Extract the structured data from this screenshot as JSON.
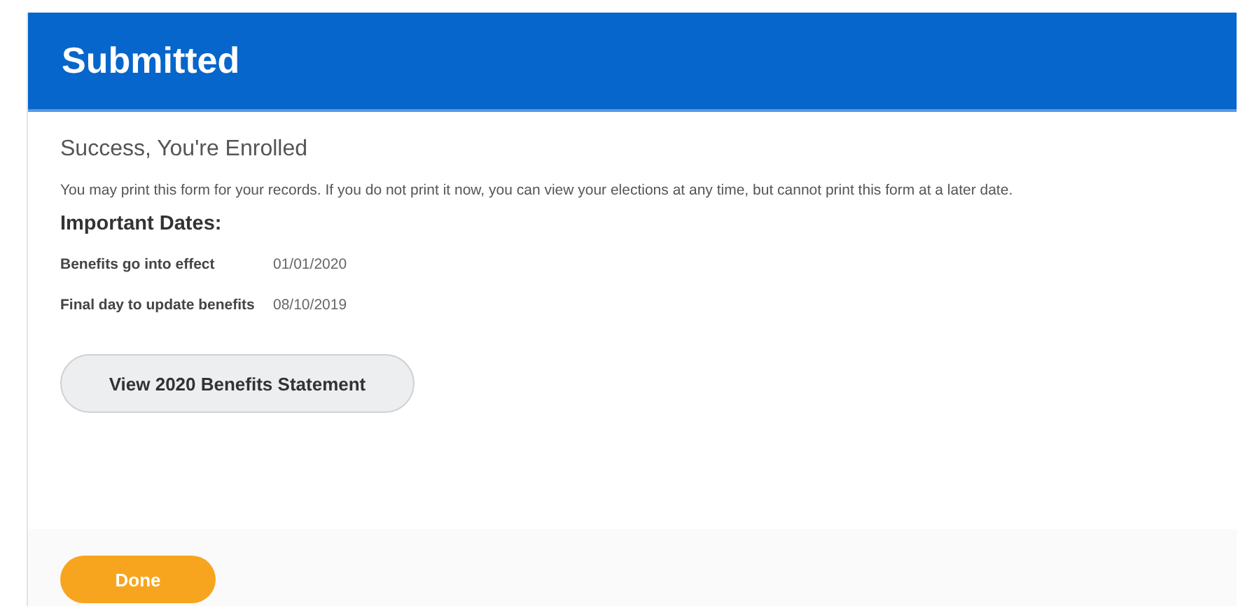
{
  "header": {
    "title": "Submitted"
  },
  "message": {
    "heading": "Success, You're Enrolled",
    "text": "You may print this form for your records. If you do not print it now, you can view your elections at any time, but cannot print this form at a later date."
  },
  "important_dates": {
    "heading": "Important Dates:",
    "rows": [
      {
        "label": "Benefits go into effect",
        "value": "01/01/2020"
      },
      {
        "label": "Final day to update benefits",
        "value": "08/10/2019"
      }
    ]
  },
  "statement_button": "View 2020 Benefits Statement",
  "footer": {
    "done_button": "Done"
  }
}
